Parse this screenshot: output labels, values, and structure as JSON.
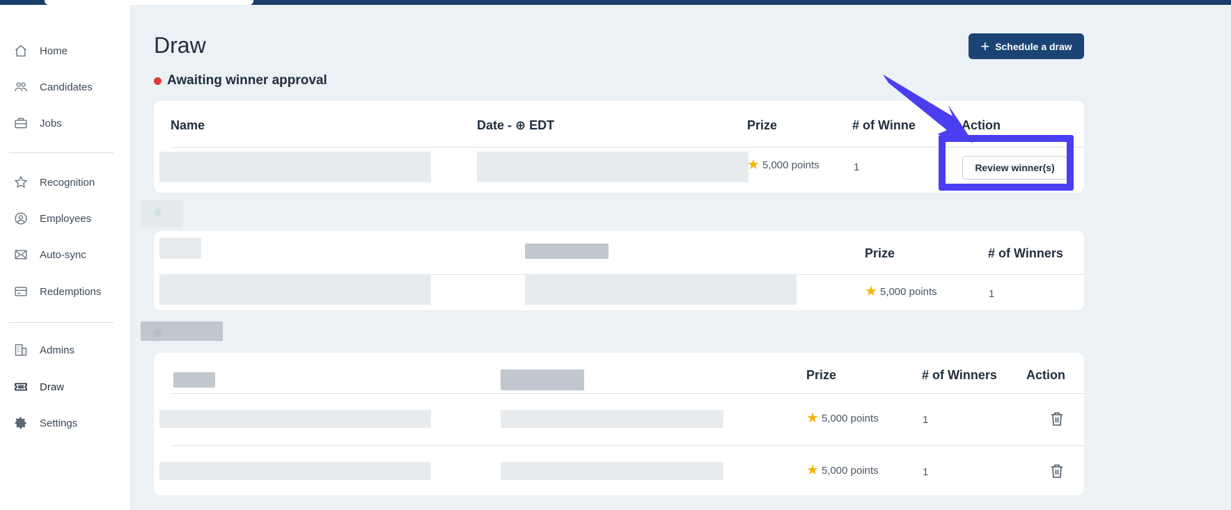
{
  "sidebar": {
    "items": [
      {
        "label": "Home",
        "icon": "home-icon"
      },
      {
        "label": "Candidates",
        "icon": "users-icon"
      },
      {
        "label": "Jobs",
        "icon": "briefcase-icon"
      },
      {
        "label": "Recognition",
        "icon": "star-icon"
      },
      {
        "label": "Employees",
        "icon": "user-circle-icon"
      },
      {
        "label": "Auto-sync",
        "icon": "mail-icon"
      },
      {
        "label": "Redemptions",
        "icon": "card-icon"
      },
      {
        "label": "Admins",
        "icon": "building-icon"
      },
      {
        "label": "Draw",
        "icon": "ticket-icon"
      },
      {
        "label": "Settings",
        "icon": "gear-icon"
      }
    ]
  },
  "page": {
    "title": "Draw",
    "schedule_button": "Schedule a draw"
  },
  "awaiting": {
    "title": "Awaiting winner approval",
    "status_color": "#e53935",
    "columns": [
      "Name",
      "Date - ⊕ EDT",
      "Prize",
      "# of Winne",
      "Action"
    ],
    "rows": [
      {
        "prize": "5,000 points",
        "winners": "1",
        "action": "Review winner(s)"
      }
    ]
  },
  "second": {
    "status_color": "#2eb872",
    "columns": [
      "Prize",
      "# of Winners"
    ],
    "rows": [
      {
        "prize": "5,000 points",
        "winners": "1"
      }
    ]
  },
  "third": {
    "status_color": "#1b4474",
    "columns": [
      "Prize",
      "# of Winners",
      "Action"
    ],
    "rows": [
      {
        "prize": "5,000 points",
        "winners": "1"
      },
      {
        "prize": "5,000 points",
        "winners": "1"
      }
    ]
  },
  "colors": {
    "primary": "#1b4474",
    "annotation": "#4b3df0",
    "star": "#f5b400"
  }
}
